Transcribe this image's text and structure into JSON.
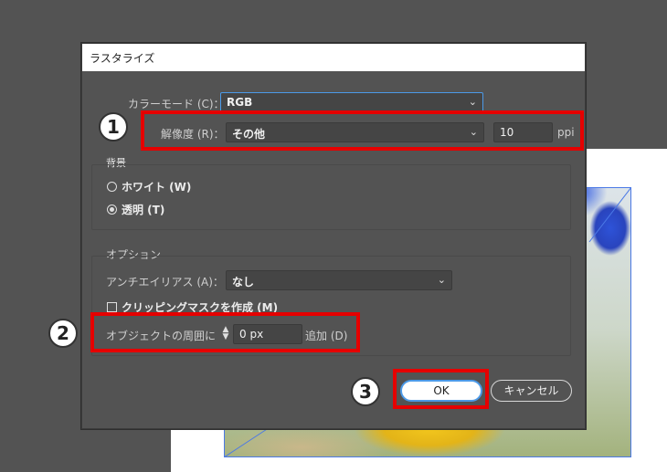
{
  "dialog": {
    "title": "ラスタライズ",
    "color_mode": {
      "label": "カラーモード (C)：",
      "value": "RGB"
    },
    "resolution": {
      "label": "解像度 (R)：",
      "value": "その他",
      "ppi_value": "10",
      "ppi_unit": "ppi"
    },
    "background": {
      "heading": "背景",
      "options": [
        {
          "label": "ホワイト (W)",
          "selected": false
        },
        {
          "label": "透明 (T)",
          "selected": true
        }
      ]
    },
    "options": {
      "heading": "オプション",
      "antialias": {
        "label": "アンチエイリアス (A)：",
        "value": "なし"
      },
      "clipping_mask": {
        "label": "クリッピングマスクを作成 (M)",
        "checked": false
      },
      "padding": {
        "prefix": "オブジェクトの周囲に",
        "value": "0 px",
        "suffix": "追加 (D)"
      }
    },
    "buttons": {
      "ok": "OK",
      "cancel": "キャンセル"
    }
  },
  "annotations": [
    "1",
    "2",
    "3"
  ],
  "colors": {
    "highlight": "#e50000",
    "focus": "#4c9ae8",
    "dialog_bg": "#535353"
  }
}
